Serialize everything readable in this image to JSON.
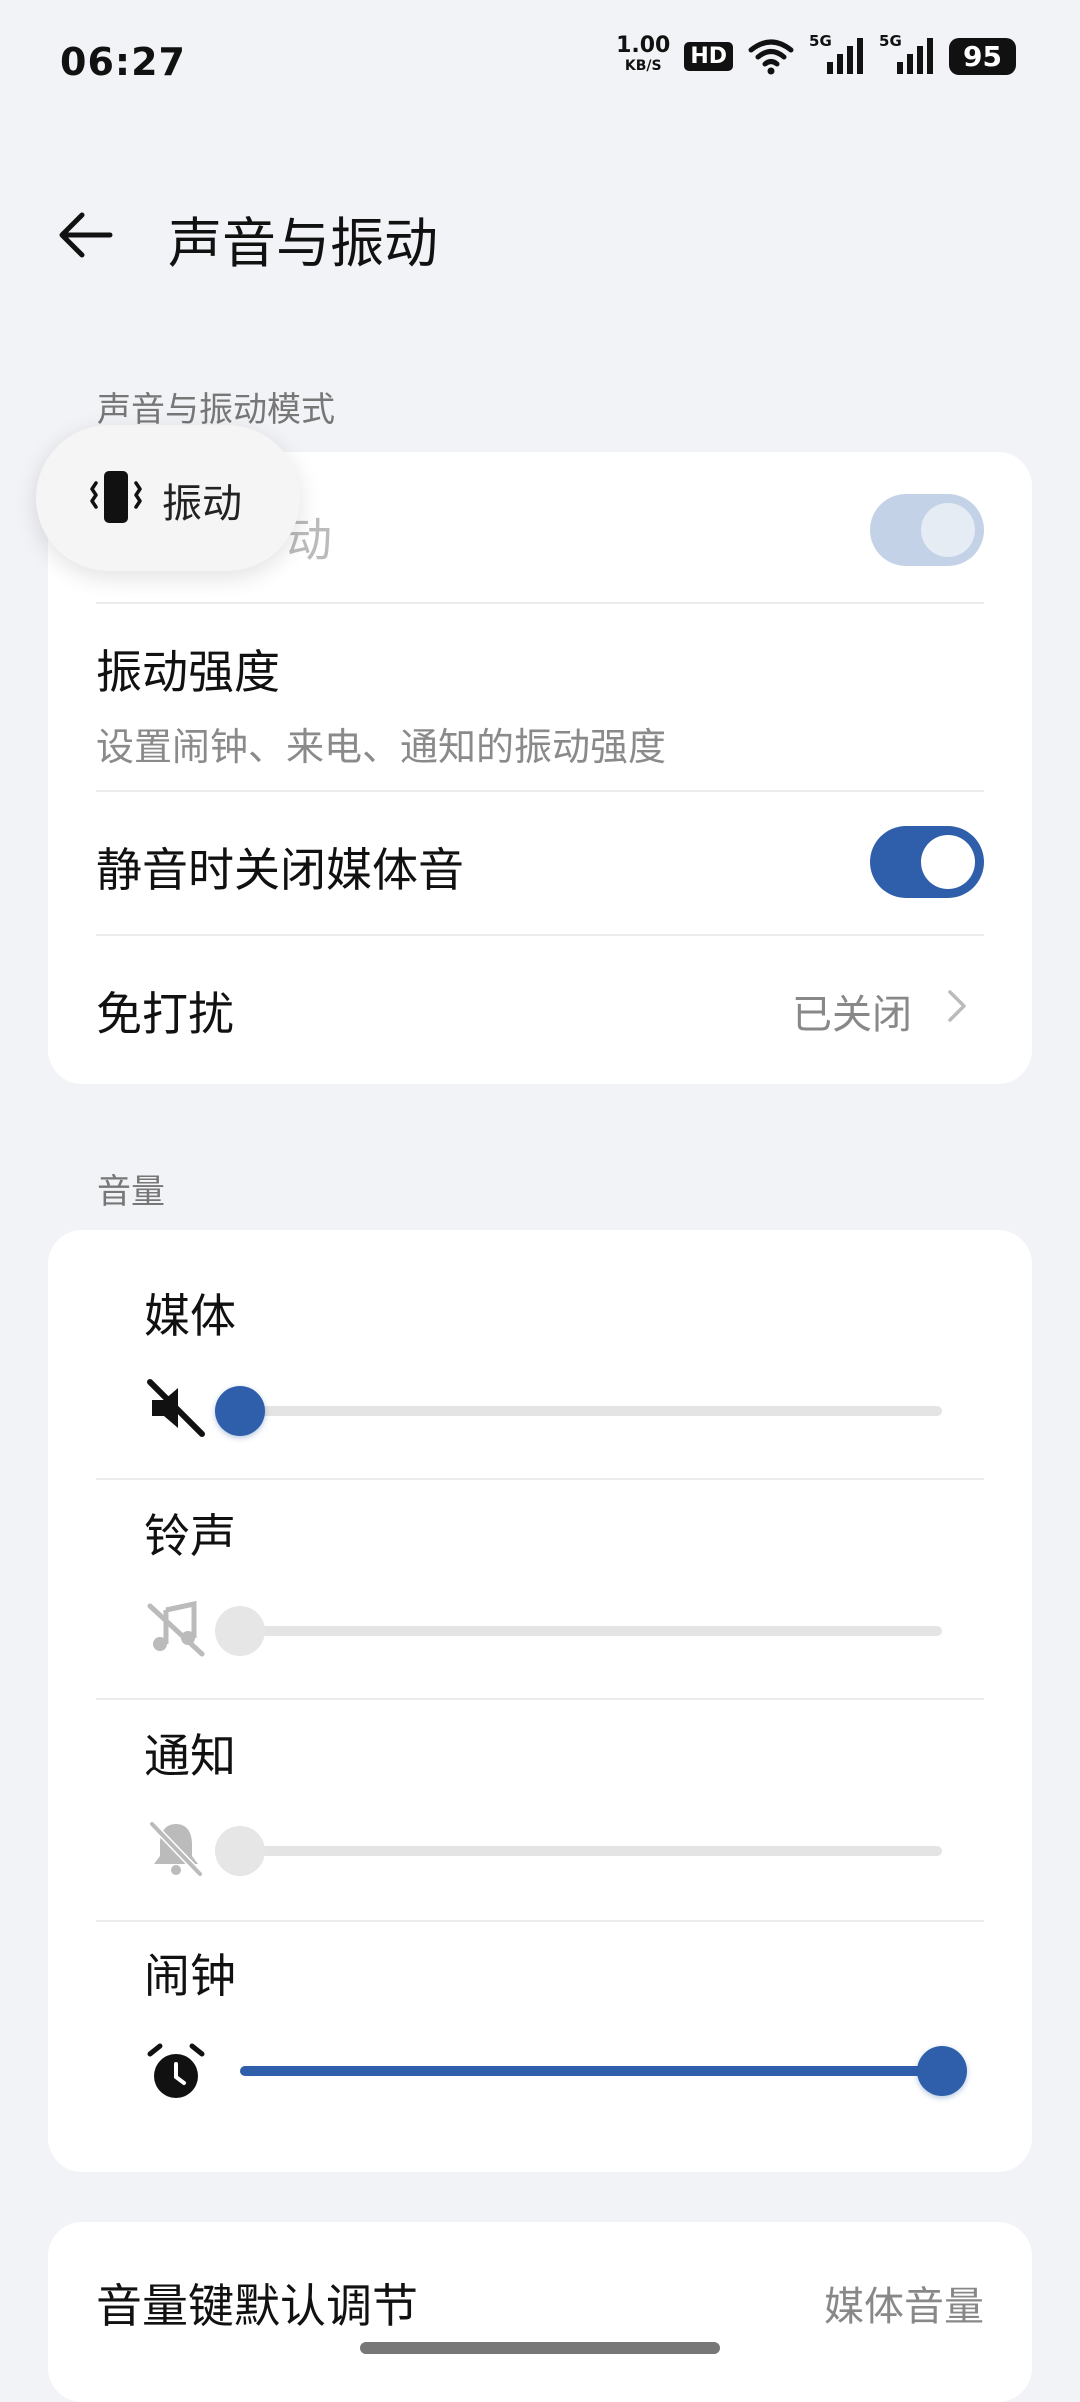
{
  "status_bar": {
    "time": "06:27",
    "net_speed": "1.00",
    "net_unit": "KB/S",
    "hd": "HD",
    "sim1_tag": "5G",
    "sim2_tag": "5G",
    "battery": "95"
  },
  "header": {
    "title": "声音与振动",
    "back_icon": "arrow-left-icon"
  },
  "mode_section": {
    "label": "声音与振动模式",
    "items": [
      {
        "title": "动",
        "toggle": "on",
        "state": "disabled"
      },
      {
        "title": "振动强度",
        "subtitle": "设置闹钟、来电、通知的振动强度"
      },
      {
        "title": "静音时关闭媒体音",
        "toggle": "on"
      },
      {
        "title": "免打扰",
        "value": "已关闭"
      }
    ]
  },
  "toast": {
    "icon": "vibrate-icon",
    "label": "振动"
  },
  "volume_section": {
    "label": "音量",
    "items": [
      {
        "title": "媒体",
        "icon": "media-muted-icon",
        "level": 0.0,
        "active": true
      },
      {
        "title": "铃声",
        "icon": "ringtone-off-icon",
        "level": 0.0,
        "active": false
      },
      {
        "title": "通知",
        "icon": "notification-off-icon",
        "level": 0.0,
        "active": false
      },
      {
        "title": "闹钟",
        "icon": "alarm-clock-icon",
        "level": 1.0,
        "active": true
      }
    ]
  },
  "volume_key": {
    "title": "音量键默认调节",
    "value": "媒体音量"
  },
  "colors": {
    "accent": "#2f5faa",
    "background": "#f2f3f7",
    "card": "#ffffff"
  }
}
